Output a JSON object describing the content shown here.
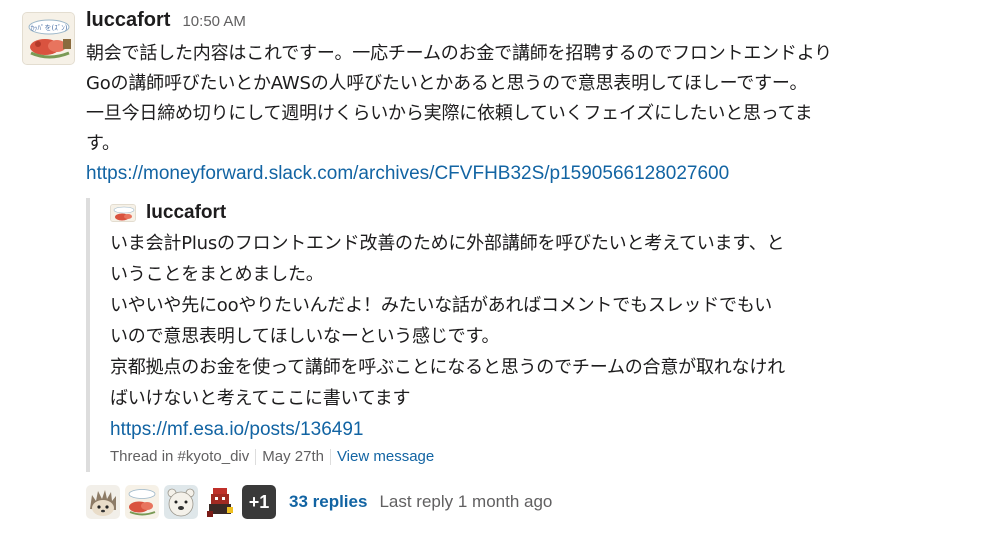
{
  "message": {
    "author": "luccafort",
    "timestamp": "10:50 AM",
    "avatar_text": "ｶｯﾊﾟを(ｽﾞﾝ)",
    "lines": [
      "朝会で話した内容はこれですー。一応チームのお金で講師を招聘するのでフロントエンドより",
      "Goの講師呼びたいとかAWSの人呼びたいとかあると思うので意思表明してほしーですー。",
      "一旦今日締め切りにして週明けくらいから実際に依頼していくフェイズにしたいと思ってま",
      "す。"
    ],
    "link": "https://moneyforward.slack.com/archives/CFVFHB32S/p1590566128027600"
  },
  "quote": {
    "author": "luccafort",
    "lines": [
      "いま会計Plusのフロントエンド改善のために外部講師を呼びたいと考えています、と",
      "いうことをまとめました。",
      "いやいや先にooやりたいんだよ！みたいな話があればコメントでもスレッドでもい",
      "いので意思表明してほしいなーという感じです。",
      "京都拠点のお金を使って講師を呼ぶことになると思うのでチームの合意が取れなけれ",
      "ばいけないと考えてここに書いてます"
    ],
    "link": "https://mf.esa.io/posts/136491",
    "footer": {
      "thread": "Thread in #kyoto_div",
      "date": "May 27th",
      "view": "View message"
    }
  },
  "thread": {
    "avatars": [
      "hedgehog-avatar",
      "luccafort-avatar",
      "bear-avatar",
      "pixel-character-avatar"
    ],
    "more": "+1",
    "replies": "33 replies",
    "last_reply": "Last reply 1 month ago"
  },
  "colors": {
    "link": "#1264a3",
    "muted": "#616061",
    "quote_border": "#dddddd"
  }
}
